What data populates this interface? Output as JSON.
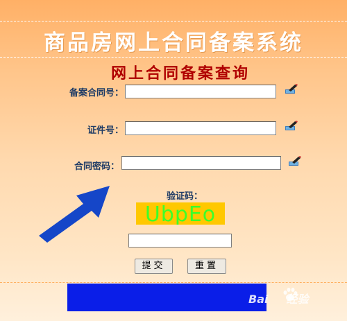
{
  "header": {
    "title": "商品房网上合同备案系统",
    "subtitle": "网上合同备案查询"
  },
  "form": {
    "contract_no": {
      "label": "备案合同号：",
      "value": ""
    },
    "id_no": {
      "label": "证件号：",
      "value": ""
    },
    "contract_password": {
      "label": "合同密码：",
      "value": ""
    },
    "captcha": {
      "label": "验证码：",
      "image_text": "UbpEo",
      "value": ""
    }
  },
  "buttons": {
    "submit": "提交",
    "reset": "重置"
  },
  "watermark": {
    "left": "Bai",
    "right": "经验"
  },
  "colors": {
    "accent_title": "#b00000",
    "label": "#1f3c66",
    "captcha_bg": "#ffc800",
    "captcha_text": "#3cff2a",
    "arrow": "#1546c8",
    "redaction_box": "#0a1ee8"
  },
  "icons": {
    "edit": "edit-icon",
    "arrow": "arrow-icon",
    "watermark": "baidu-paw-icon"
  }
}
